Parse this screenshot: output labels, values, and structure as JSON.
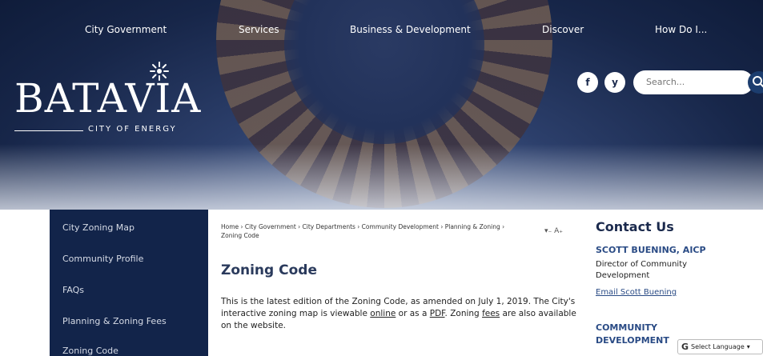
{
  "nav": {
    "items": [
      {
        "label": "City Government"
      },
      {
        "label": "Services"
      },
      {
        "label": "Business & Development"
      },
      {
        "label": "Discover"
      },
      {
        "label": "How Do I..."
      }
    ]
  },
  "logo": {
    "name": "BATAVIA",
    "tagline": "CITY OF ENERGY"
  },
  "social": {
    "facebook": "f",
    "twitter": "y"
  },
  "search": {
    "placeholder": "Search..."
  },
  "sidebar": {
    "items": [
      {
        "label": "City Zoning Map"
      },
      {
        "label": "Community Profile"
      },
      {
        "label": "FAQs"
      },
      {
        "label": "Planning & Zoning Fees"
      },
      {
        "label": "Zoning Code"
      }
    ]
  },
  "content": {
    "breadcrumb": "Home › City Government › City Departments › Community Development › Planning & Zoning › Zoning Code",
    "font_tools": "▾₋ A₊",
    "title": "Zoning Code",
    "text_1": "This is the latest edition of the Zoning Code, as amended on July 1, 2019. The City's interactive zoning map is viewable ",
    "link_online": "online",
    "text_2": " or as a ",
    "link_pdf": "PDF",
    "text_3": ". Zoning ",
    "link_fees": "fees",
    "text_4": " are also available on the website."
  },
  "contact": {
    "title": "Contact Us",
    "name": "SCOTT BUENING, AICP",
    "role": "Director of Community Development",
    "email_link": "Email Scott Buening",
    "department": "COMMUNITY DEVELOPMENT"
  },
  "translate": {
    "label": "Select Language"
  },
  "colors": {
    "navy": "#12244a",
    "accent": "#2a4b85",
    "title": "#2a3a5c"
  }
}
